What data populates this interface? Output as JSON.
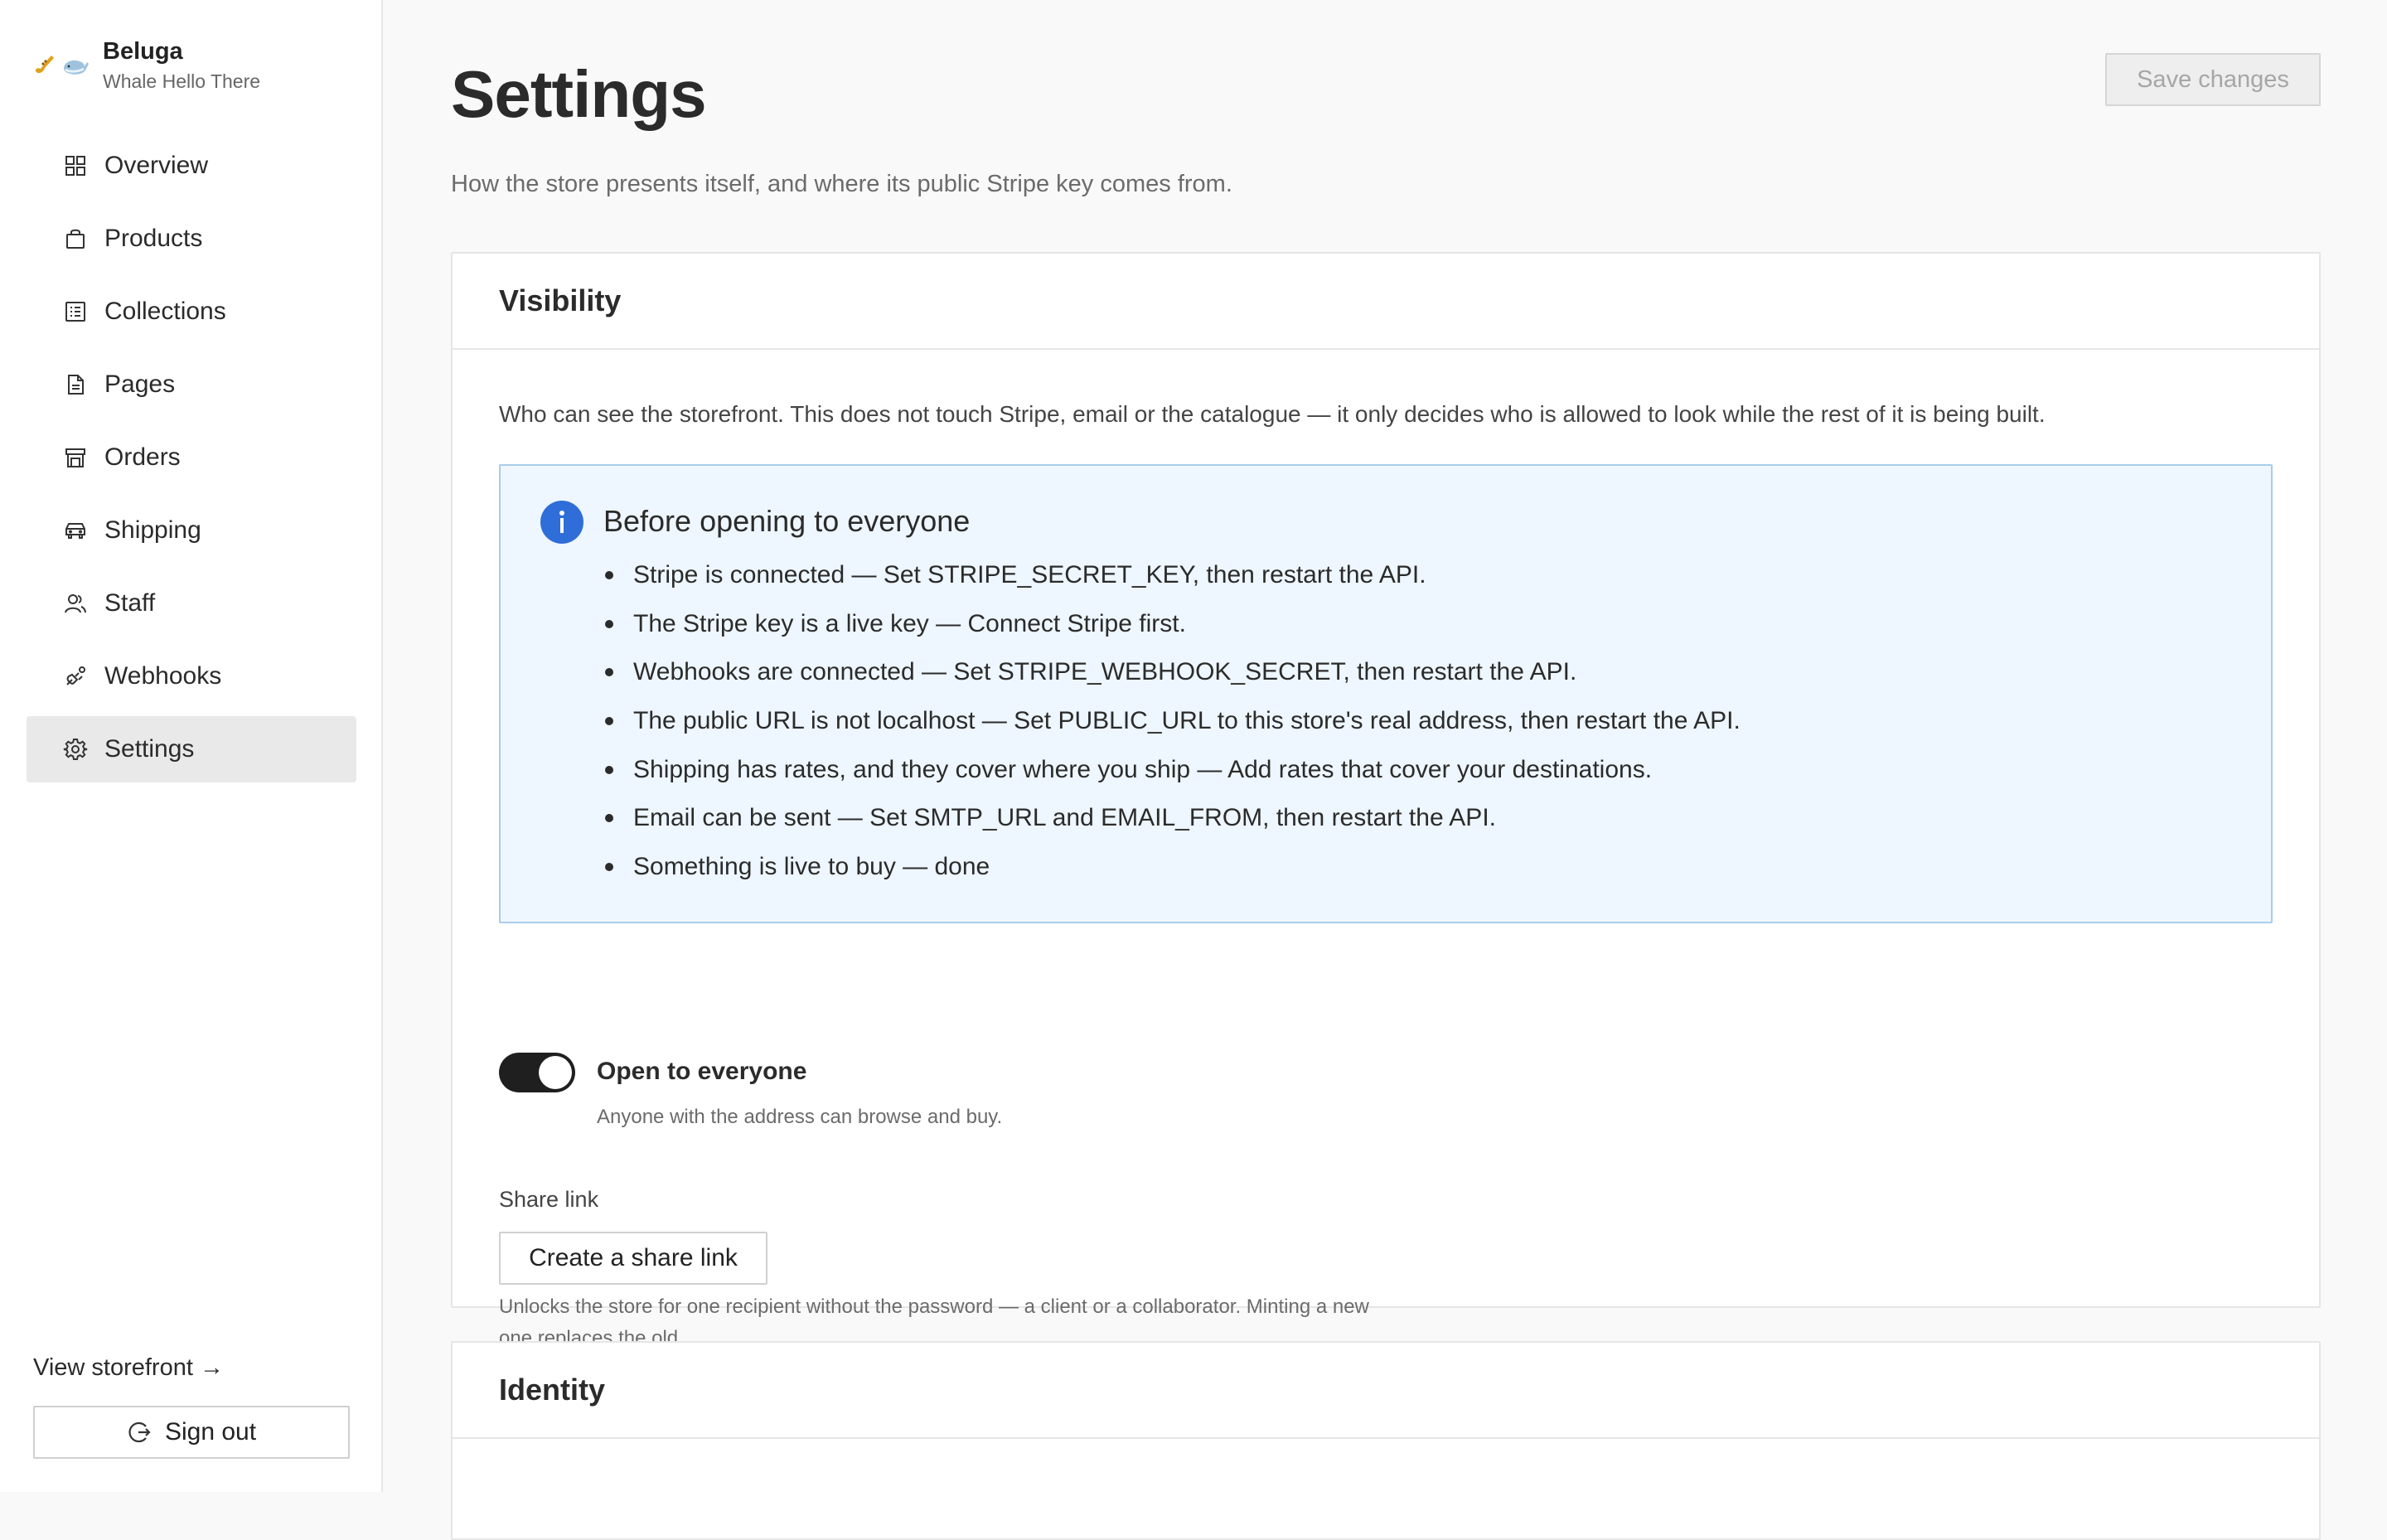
{
  "brand": {
    "name": "Beluga",
    "tagline": "Whale Hello There",
    "logo_icons": [
      "saxophone-icon",
      "whale-icon"
    ]
  },
  "sidebar": {
    "items": [
      {
        "label": "Overview",
        "icon": "grid-icon",
        "active": false
      },
      {
        "label": "Products",
        "icon": "bag-icon",
        "active": false
      },
      {
        "label": "Collections",
        "icon": "list-icon",
        "active": false
      },
      {
        "label": "Pages",
        "icon": "document-icon",
        "active": false
      },
      {
        "label": "Orders",
        "icon": "store-icon",
        "active": false
      },
      {
        "label": "Shipping",
        "icon": "car-icon",
        "active": false
      },
      {
        "label": "Staff",
        "icon": "users-icon",
        "active": false
      },
      {
        "label": "Webhooks",
        "icon": "webhook-icon",
        "active": false
      },
      {
        "label": "Settings",
        "icon": "gear-icon",
        "active": true
      }
    ],
    "view_storefront": "View storefront →",
    "sign_out": "Sign out"
  },
  "page": {
    "title": "Settings",
    "description": "How the store presents itself, and where its public Stripe key comes from.",
    "save_label": "Save changes"
  },
  "visibility": {
    "title": "Visibility",
    "description": "Who can see the storefront. This does not touch Stripe, email or the catalogue — it only decides who is allowed to look while the rest of it is being built.",
    "callout": {
      "title": "Before opening to everyone",
      "items": [
        "Stripe is connected — Set STRIPE_SECRET_KEY, then restart the API.",
        "The Stripe key is a live key — Connect Stripe first.",
        "Webhooks are connected — Set STRIPE_WEBHOOK_SECRET, then restart the API.",
        "The public URL is not localhost — Set PUBLIC_URL to this store's real address, then restart the API.",
        "Shipping has rates, and they cover where you ship — Add rates that cover your destinations.",
        "Email can be sent — Set SMTP_URL and EMAIL_FROM, then restart the API.",
        "Something is live to buy — done"
      ]
    },
    "toggle": {
      "label": "Open to everyone",
      "help": "Anyone with the address can browse and buy.",
      "on": true
    },
    "share": {
      "label": "Share link",
      "button": "Create a share link",
      "help": "Unlocks the store for one recipient without the password — a client or a collaborator. Minting a new one replaces the old."
    }
  },
  "identity": {
    "title": "Identity"
  },
  "colors": {
    "accent_info": "#2f6ed8",
    "callout_bg": "#eef6ff",
    "callout_border": "#a9cdea",
    "toggle_on": "#1f1f1f"
  }
}
